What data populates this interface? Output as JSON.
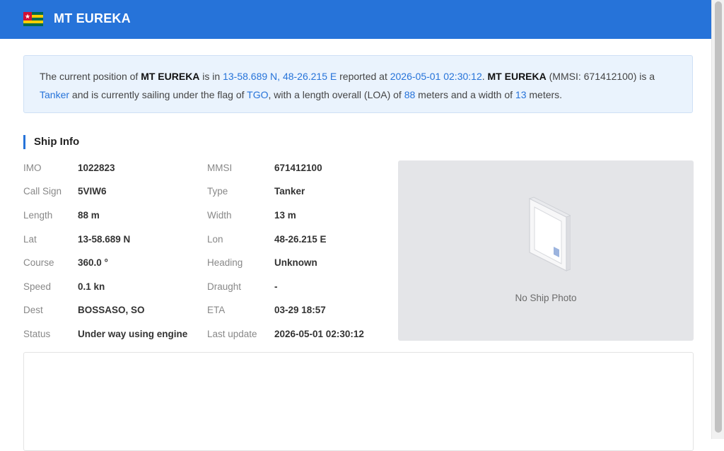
{
  "header": {
    "ship_name": "MT EUREKA",
    "flag_icon": "togo-flag-icon"
  },
  "summary": {
    "t1": "The current position of ",
    "name1": "MT EUREKA",
    "t2": " is in ",
    "position": "13-58.689 N, 48-26.215 E",
    "t3": " reported at ",
    "reported": "2026-05-01 02:30:12",
    "t4": ". ",
    "name2": "MT EUREKA",
    "t5": " (MMSI: 671412100) is a ",
    "type": "Tanker",
    "t6": " and is currently sailing under the flag of ",
    "flag": "TGO",
    "t7": ", with a length overall (LOA) of ",
    "length": "88",
    "t8": " meters and a width of ",
    "width": "13",
    "t9": " meters."
  },
  "section_title": "Ship Info",
  "info": {
    "left": [
      {
        "label": "IMO",
        "value": "1022823"
      },
      {
        "label": "Call Sign",
        "value": "5VIW6"
      },
      {
        "label": "Length",
        "value": "88 m"
      },
      {
        "label": "Lat",
        "value": "13-58.689 N"
      },
      {
        "label": "Course",
        "value": "360.0 °"
      },
      {
        "label": "Speed",
        "value": "0.1 kn"
      },
      {
        "label": "Dest",
        "value": "BOSSASO, SO"
      },
      {
        "label": "Status",
        "value": "Under way using engine"
      }
    ],
    "right": [
      {
        "label": "MMSI",
        "value": "671412100"
      },
      {
        "label": "Type",
        "value": "Tanker"
      },
      {
        "label": "Width",
        "value": "13 m"
      },
      {
        "label": "Lon",
        "value": "48-26.215 E"
      },
      {
        "label": "Heading",
        "value": "Unknown"
      },
      {
        "label": "Draught",
        "value": "-"
      },
      {
        "label": "ETA",
        "value": "03-29 18:57"
      },
      {
        "label": "Last update",
        "value": "2026-05-01 02:30:12"
      }
    ]
  },
  "photo": {
    "caption": "No Ship Photo",
    "icon": "picture-frame-icon"
  },
  "colors": {
    "header_bg": "#2673d9",
    "accent": "#2673d9",
    "summary_bg": "#eaf3fd"
  }
}
